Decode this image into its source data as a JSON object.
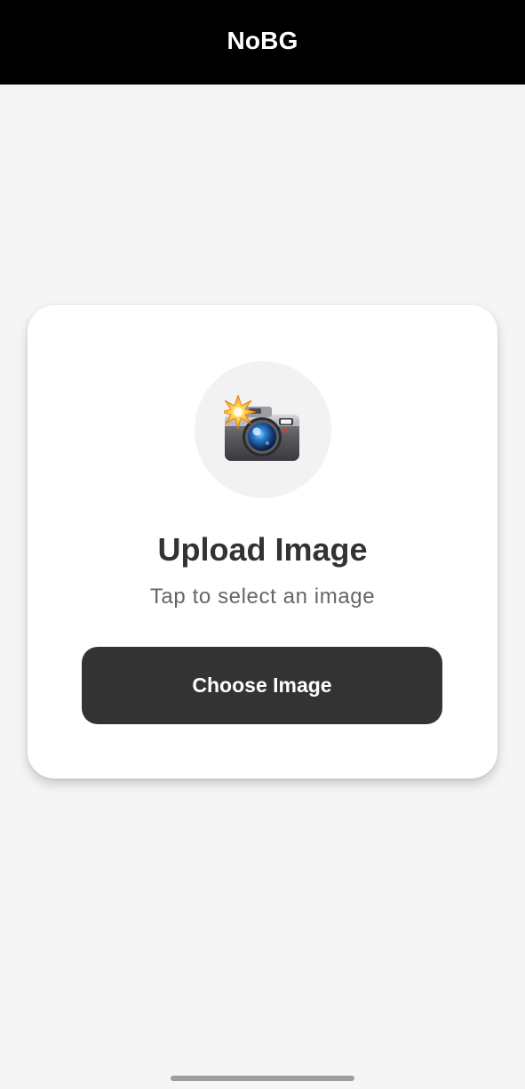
{
  "header": {
    "title": "NoBG",
    "background": "#000000",
    "text_color": "#ffffff"
  },
  "upload_card": {
    "icon": "camera-with-flash-icon",
    "title": "Upload Image",
    "subtitle": "Tap to select an image",
    "button_label": "Choose Image",
    "button_color": "#333333"
  },
  "colors": {
    "page_background": "#f5f5f5",
    "card_background": "#ffffff",
    "title_text": "#333333",
    "subtitle_text": "#666666"
  }
}
